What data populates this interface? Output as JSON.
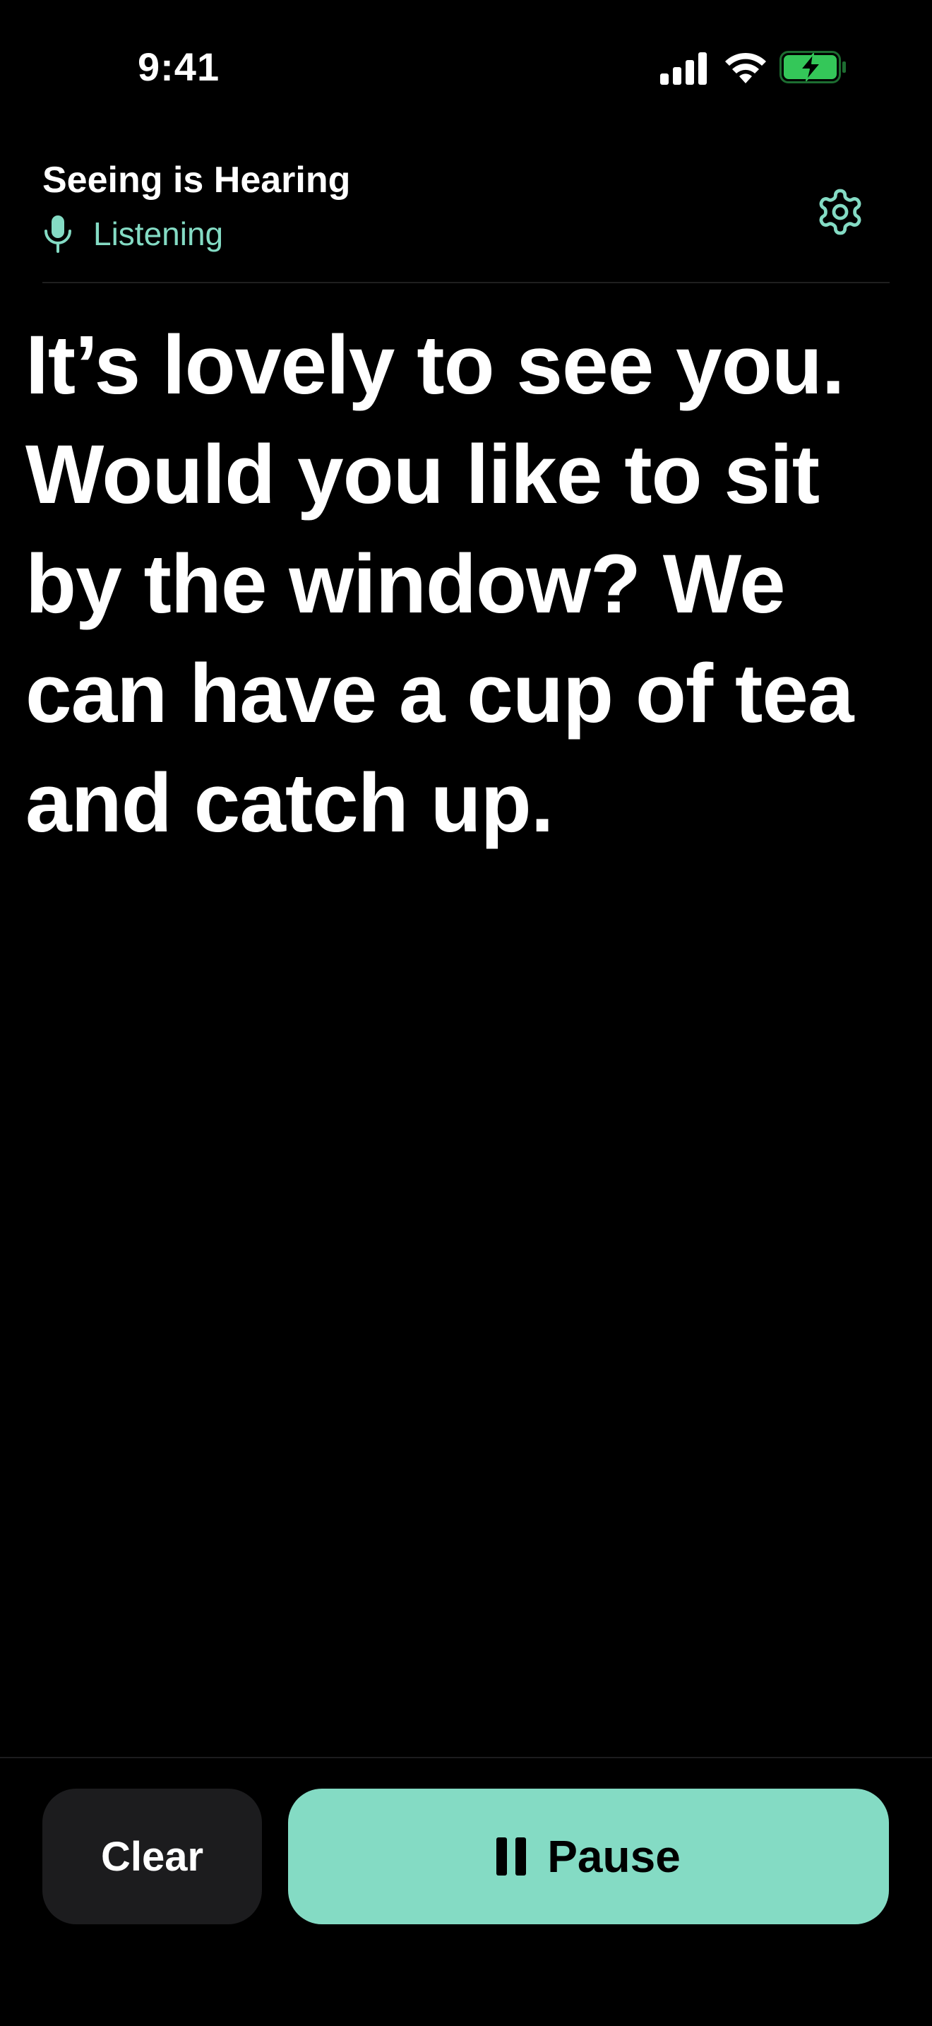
{
  "status_bar": {
    "time": "9:41",
    "icons": [
      "signal-icon",
      "wifi-icon",
      "battery-charging-icon"
    ]
  },
  "header": {
    "app_title": "Seeing is Hearing",
    "status_label": "Listening",
    "status_icon": "mic-icon",
    "settings_icon": "gear-icon"
  },
  "transcript": {
    "text": "It’s lovely to see you. Would you like to sit by the window? We can have a cup of tea and catch up."
  },
  "controls": {
    "clear_label": "Clear",
    "pause_label": "Pause",
    "pause_icon": "pause-icon"
  },
  "colors": {
    "background": "#000000",
    "accent": "#84dbc4",
    "secondary_button": "#1c1c1e",
    "battery_fill": "#34c759"
  }
}
